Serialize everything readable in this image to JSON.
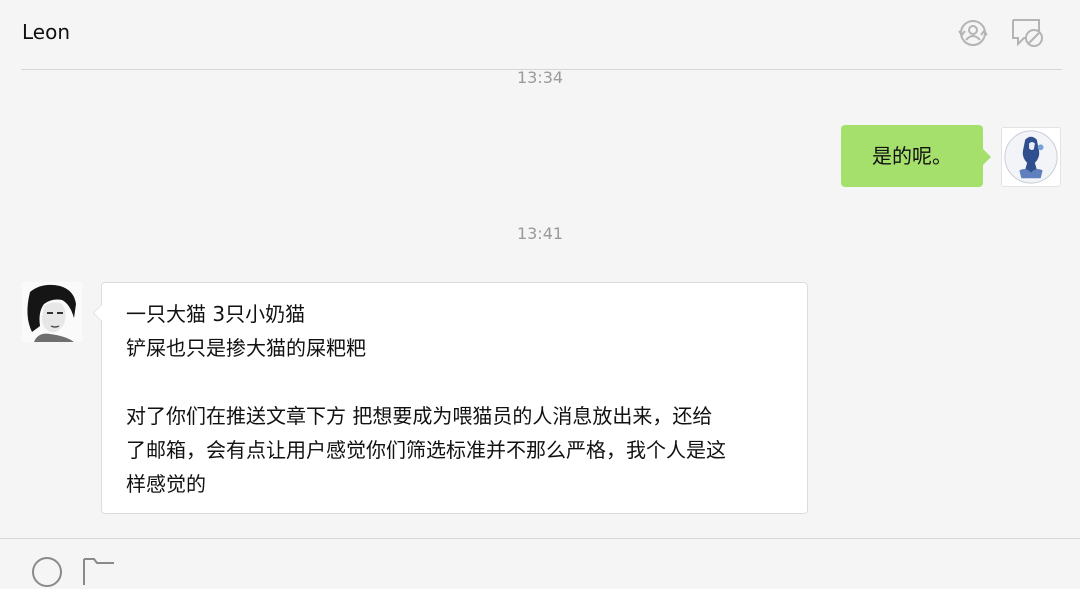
{
  "header": {
    "title": "Leon",
    "icons": [
      "contact-info-icon",
      "block-chat-icon"
    ]
  },
  "messages": [
    {
      "type": "timestamp",
      "text": "13:34"
    },
    {
      "type": "outgoing",
      "text": "是的呢。",
      "bubble_color": "#a5e06c"
    },
    {
      "type": "timestamp",
      "text": "13:41"
    },
    {
      "type": "incoming",
      "lines": [
        "一只大猫  3只小奶猫",
        "铲屎也只是掺大猫的屎粑粑",
        "",
        "对了你们在推送文章下方 把想要成为喂猫员的人消息放出来，还给",
        "了邮箱，会有点让用户感觉你们筛选标准并不那么严格，我个人是这",
        "样感觉的"
      ]
    }
  ],
  "input_toolbar": {
    "icons": [
      "emoji-icon",
      "folder-icon"
    ]
  },
  "colors": {
    "background": "#f5f5f5",
    "outgoing_bubble": "#a5e06c",
    "incoming_bubble": "#ffffff",
    "timestamp_text": "#9a9a9a"
  }
}
